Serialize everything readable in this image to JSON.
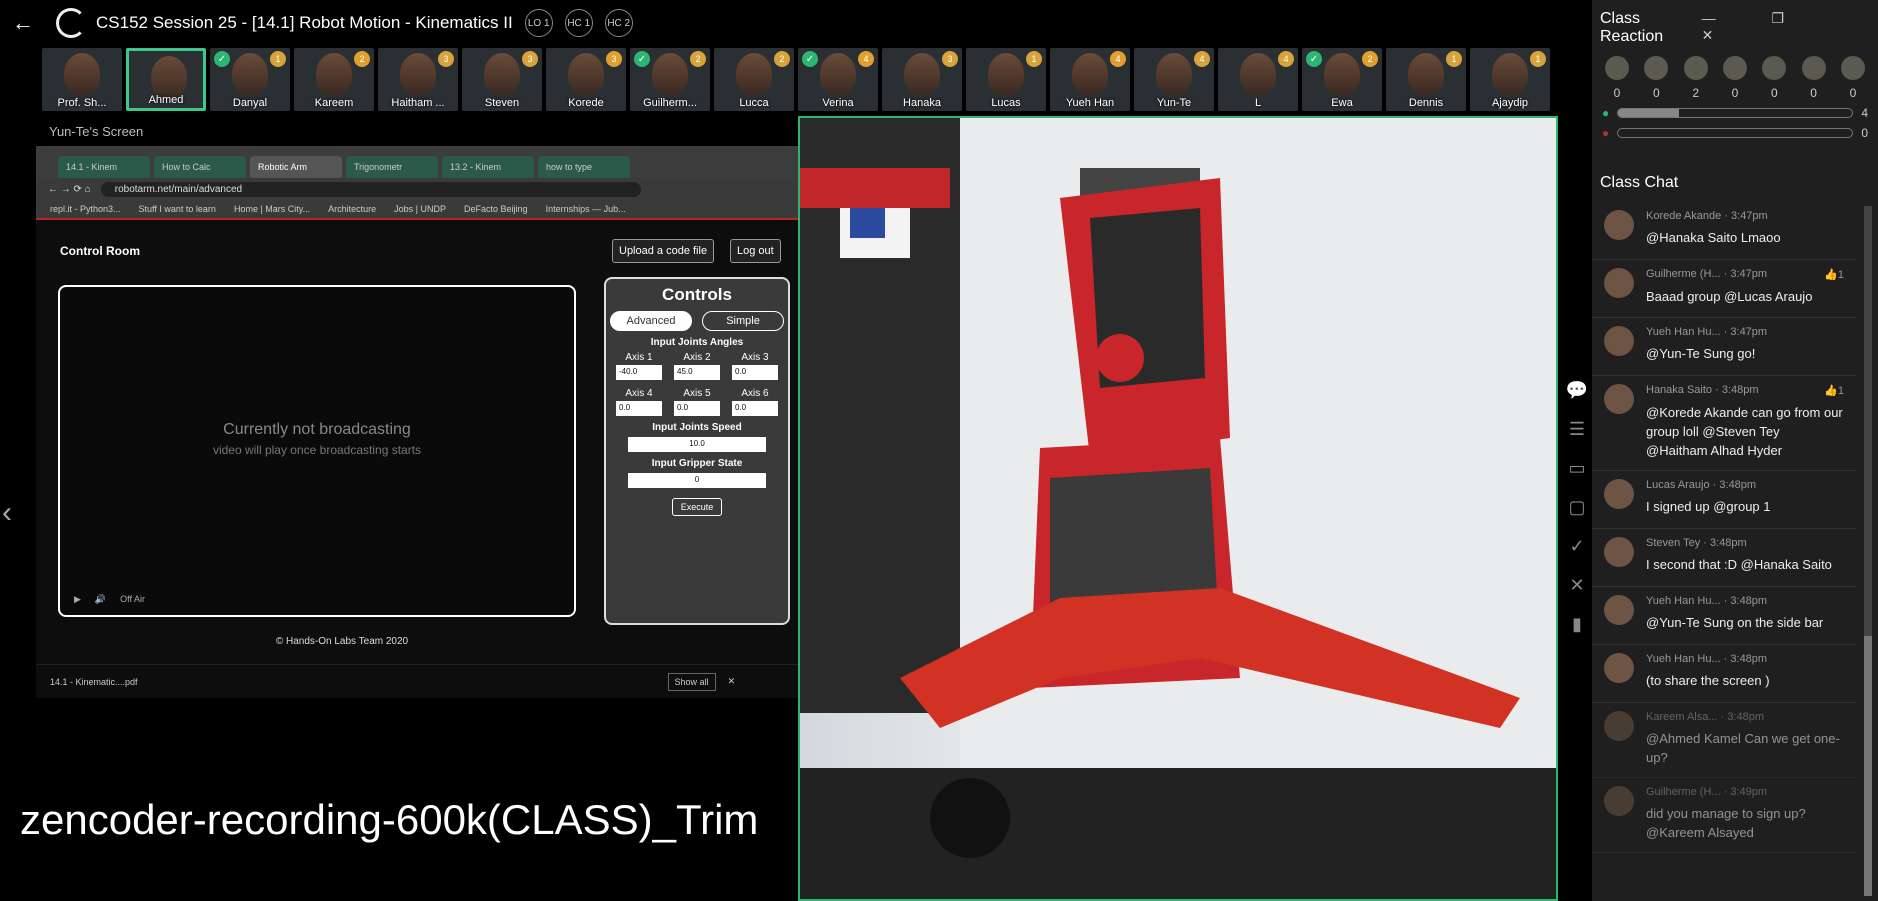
{
  "header": {
    "title": "CS152 Session 25 - [14.1] Robot Motion - Kinematics II",
    "pills": [
      "LO 1",
      "HC 1",
      "HC 2"
    ]
  },
  "participants": [
    {
      "name": "Prof. Sh...",
      "count": "",
      "check": false,
      "star": true
    },
    {
      "name": "Ahmed",
      "count": "",
      "check": false,
      "star": true,
      "highlight": true
    },
    {
      "name": "Danyal",
      "count": "1",
      "check": true
    },
    {
      "name": "Kareem",
      "count": "2",
      "check": false
    },
    {
      "name": "Haitham ...",
      "count": "3",
      "check": false
    },
    {
      "name": "Steven",
      "count": "3",
      "check": false
    },
    {
      "name": "Korede",
      "count": "3",
      "check": false
    },
    {
      "name": "Guilherm...",
      "count": "2",
      "check": true
    },
    {
      "name": "Lucca",
      "count": "2",
      "check": false
    },
    {
      "name": "Verina",
      "count": "4",
      "check": true
    },
    {
      "name": "Hanaka",
      "count": "3",
      "check": false
    },
    {
      "name": "Lucas",
      "count": "1",
      "check": false
    },
    {
      "name": "Yueh Han",
      "count": "4",
      "check": false
    },
    {
      "name": "Yun-Te",
      "count": "4",
      "check": false
    },
    {
      "name": "L",
      "count": "4",
      "check": false
    },
    {
      "name": "Ewa",
      "count": "2",
      "check": true
    },
    {
      "name": "Dennis",
      "count": "1",
      "check": false
    },
    {
      "name": "Ajaydip",
      "count": "1",
      "check": false
    }
  ],
  "screen": {
    "sharer": "Yun-Te's Screen",
    "tabs": [
      "14.1 - Kinem",
      "How to Calc",
      "Robotic Arm",
      "Trigonometr",
      "13.2 - Kinem",
      "how to type"
    ],
    "url": "robotarm.net/main/advanced",
    "bookmarks": [
      "repl.it - Python3...",
      "Stuff I want to learn",
      "Home | Mars City...",
      "Architecture",
      "Jobs | UNDP",
      "DeFacto Beijing",
      "Internships — Jub..."
    ],
    "page_title": "Control Room",
    "upload": "Upload a code file",
    "logout": "Log out",
    "not_broadcasting": "Currently not broadcasting",
    "will_play": "video will play once broadcasting starts",
    "off_air": "Off Air",
    "controls": {
      "title": "Controls",
      "advanced": "Advanced",
      "simple": "Simple",
      "angles_label": "Input Joints Angles",
      "axes": [
        {
          "label": "Axis 1",
          "value": "-40.0"
        },
        {
          "label": "Axis 2",
          "value": "45.0"
        },
        {
          "label": "Axis 3",
          "value": "0.0"
        },
        {
          "label": "Axis 4",
          "value": "0.0"
        },
        {
          "label": "Axis 5",
          "value": "0.0"
        },
        {
          "label": "Axis 6",
          "value": "0.0"
        }
      ],
      "speed_label": "Input Joints Speed",
      "speed": "10.0",
      "gripper_label": "Input Gripper State",
      "gripper": "0",
      "execute": "Execute"
    },
    "copyright": "© Hands-On Labs Team 2020",
    "download": "14.1 - Kinematic....pdf",
    "show_all": "Show all"
  },
  "watermark": "zencoder-recording-600k(CLASS)_Trim",
  "sidebar": {
    "reaction_title": "Class Reaction",
    "emoji_counts": [
      "0",
      "0",
      "2",
      "0",
      "0",
      "0",
      "0"
    ],
    "poll": [
      {
        "value": "4",
        "fraction": 0.26
      },
      {
        "value": "0",
        "fraction": 0
      }
    ],
    "chat_title": "Class Chat",
    "messages": [
      {
        "author": "Korede Akande",
        "time": "3:47pm",
        "text": "@Hanaka Saito Lmaoo",
        "likes": ""
      },
      {
        "author": "Guilherme (H...",
        "time": "3:47pm",
        "text": "Baaad group @Lucas Araujo",
        "likes": "1"
      },
      {
        "author": "Yueh Han Hu...",
        "time": "3:47pm",
        "text": "@Yun-Te Sung go!",
        "likes": ""
      },
      {
        "author": "Hanaka Saito",
        "time": "3:48pm",
        "text": "@Korede Akande can go from our group loll @Steven Tey @Haitham Alhad Hyder",
        "likes": "1"
      },
      {
        "author": "Lucas Araujo",
        "time": "3:48pm",
        "text": "I signed up @group 1",
        "likes": ""
      },
      {
        "author": "Steven Tey",
        "time": "3:48pm",
        "text": "I second that :D @Hanaka Saito",
        "likes": ""
      },
      {
        "author": "Yueh Han Hu...",
        "time": "3:48pm",
        "text": "@Yun-Te Sung on the side bar",
        "likes": ""
      },
      {
        "author": "Yueh Han Hu...",
        "time": "3:48pm",
        "text": "(to share the screen )",
        "likes": ""
      },
      {
        "author": "Kareem Alsa...",
        "time": "3:48pm",
        "text": "@Ahmed Kamel Can we get one-up?",
        "likes": ""
      },
      {
        "author": "Guilherme (H...",
        "time": "3:49pm",
        "text": "did you manage to sign up? @Kareem Alsayed",
        "likes": ""
      }
    ]
  }
}
